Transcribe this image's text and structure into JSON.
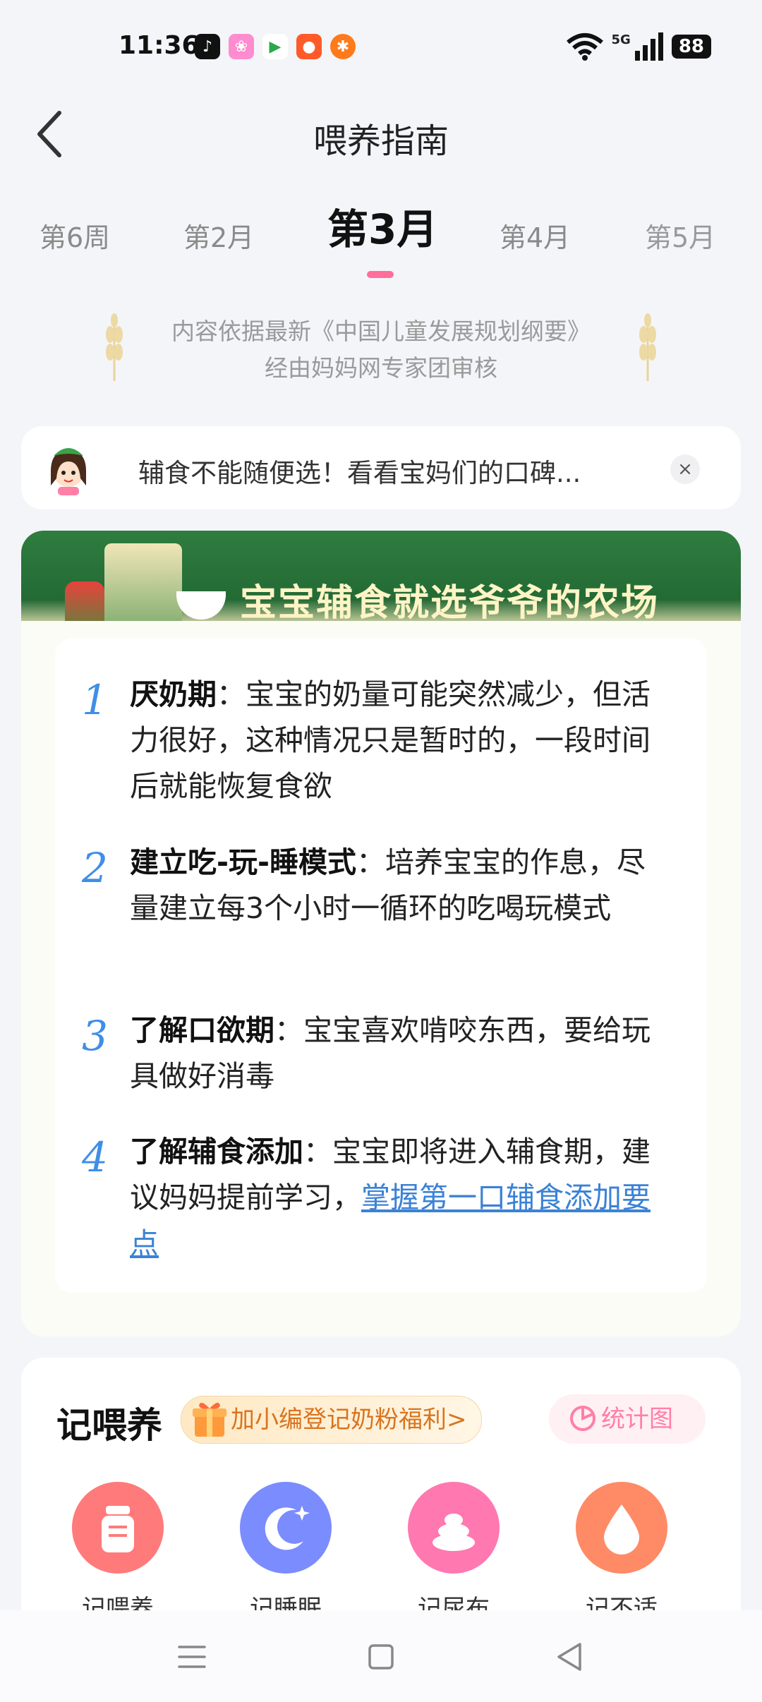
{
  "status_bar": {
    "time": "11:36",
    "network": "5G",
    "battery": "88"
  },
  "header": {
    "title": "喂养指南"
  },
  "tabs": [
    "第6周",
    "第2月",
    "第3月",
    "第4月",
    "第5月"
  ],
  "active_tab": "第3月",
  "source_note": {
    "line1": "内容依据最新《中国儿童发展规划纲要》",
    "line2": "经由妈妈网专家团审核"
  },
  "promo": {
    "text": "辅食不能随便选！看看宝妈们的口碑...",
    "close": "×"
  },
  "ad": {
    "text": "宝宝辅食就选爷爷的农场"
  },
  "tips": [
    {
      "num": "1",
      "title": "厌奶期",
      "body": "：宝宝的奶量可能突然减少，但活力很好，这种情况只是暂时的，一段时间后就能恢复食欲"
    },
    {
      "num": "2",
      "title": "建立吃-玩-睡模式",
      "body": "：培养宝宝的作息，尽量建立每3个小时一循环的吃喝玩模式"
    },
    {
      "num": "3",
      "title": "了解口欲期",
      "body": "：宝宝喜欢啃咬东西，要给玩具做好消毒"
    },
    {
      "num": "4",
      "title": "了解辅食添加",
      "body": "：宝宝即将进入辅食期，建议妈妈提前学习，",
      "link": "掌握第一口辅食添加要点"
    }
  ],
  "record": {
    "title": "记喂养",
    "welfare": "加小编登记奶粉福利>",
    "chart_button": "统计图",
    "features": [
      {
        "label": "记喂养",
        "icon": "bottle-icon",
        "color": "#ff7a7a"
      },
      {
        "label": "记睡眠",
        "icon": "moon-icon",
        "color": "#7b8cff"
      },
      {
        "label": "记尿布",
        "icon": "poop-icon",
        "color": "#ff78b0"
      },
      {
        "label": "记不适",
        "icon": "drop-icon",
        "color": "#ff8a66"
      }
    ]
  },
  "colors": {
    "accent_pink": "#ff6f9a",
    "tip_blue": "#3f8ee8",
    "ad_green": "#2f7d3f"
  }
}
